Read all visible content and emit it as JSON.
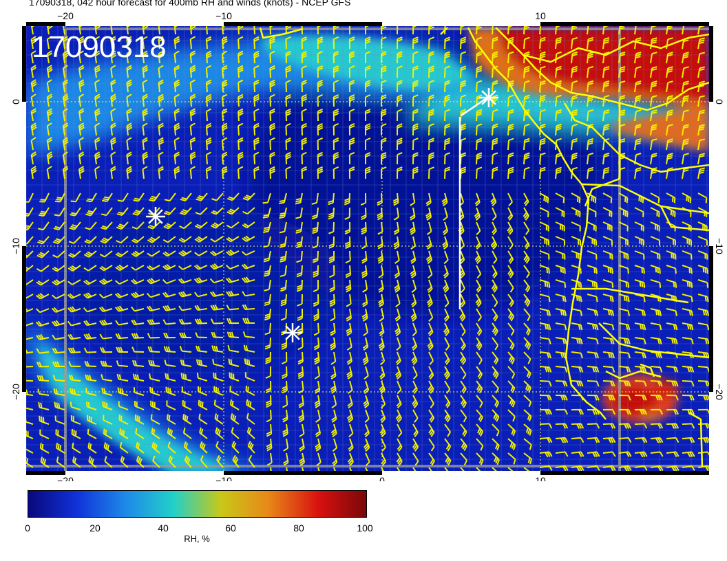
{
  "title": "17090318, 042 hour forecast for 400mb RH and winds (knots) - NCEP GFS",
  "stamp": "17090318",
  "x_ticks": [
    "−20",
    "−10",
    "0",
    "10"
  ],
  "y_ticks": [
    "0",
    "−10",
    "−20"
  ],
  "colorbar": {
    "title": "RH, %",
    "ticks": [
      "0",
      "20",
      "40",
      "60",
      "80",
      "100"
    ],
    "colors": [
      "#08087a",
      "#1030d8",
      "#1e8ae8",
      "#22d0c8",
      "#c8c818",
      "#e88818",
      "#d81010",
      "#7a0808"
    ]
  },
  "colors": {
    "ocean_base": "#0a1fb8",
    "barb": "#f2f000",
    "coast": "#ffff00",
    "marker": "#ffffff"
  },
  "map_extent": {
    "lon": [
      -22.5,
      20.5
    ],
    "lat": [
      -25.5,
      5
    ]
  }
}
